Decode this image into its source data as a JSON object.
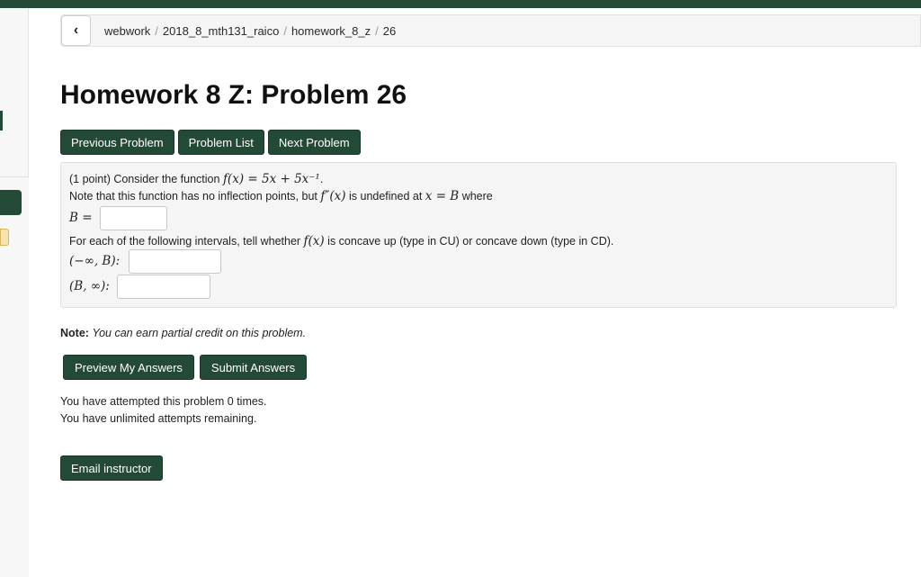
{
  "breadcrumb": {
    "back_glyph": "‹",
    "items": [
      "webwork",
      "2018_8_mth131_raico",
      "homework_8_z",
      "26"
    ],
    "separator": "/"
  },
  "page": {
    "title": "Homework 8 Z: Problem 26"
  },
  "nav_buttons": {
    "previous": "Previous Problem",
    "list": "Problem List",
    "next": "Next Problem"
  },
  "problem": {
    "intro_prefix": "(1 point) Consider the function ",
    "function_math": "f(x) = 5x + 5x⁻¹",
    "intro_suffix": ".",
    "inflection_prefix": "Note that this function has no inflection points, but ",
    "second_derivative_math": "f″(x)",
    "inflection_middle": " is undefined at ",
    "at_math": "x = B",
    "inflection_suffix": " where",
    "b_label": "B =",
    "b_value": "",
    "concavity_prefix": "For each of the following intervals, tell whether ",
    "concavity_math": "f(x)",
    "concavity_suffix": " is concave up (type in CU) or concave down (type in CD).",
    "interval1_label": "(−∞, B):",
    "interval1_value": "",
    "interval2_label": "(B, ∞):",
    "interval2_value": ""
  },
  "note": {
    "label": "Note:",
    "text": "You can earn partial credit on this problem."
  },
  "actions": {
    "preview": "Preview My Answers",
    "submit": "Submit Answers"
  },
  "attempts": {
    "line1": "You have attempted this problem 0 times.",
    "line2": "You have unlimited attempts remaining."
  },
  "email_button": "Email instructor",
  "colors": {
    "accent": "#234a36",
    "panel": "#f5f5f5"
  }
}
